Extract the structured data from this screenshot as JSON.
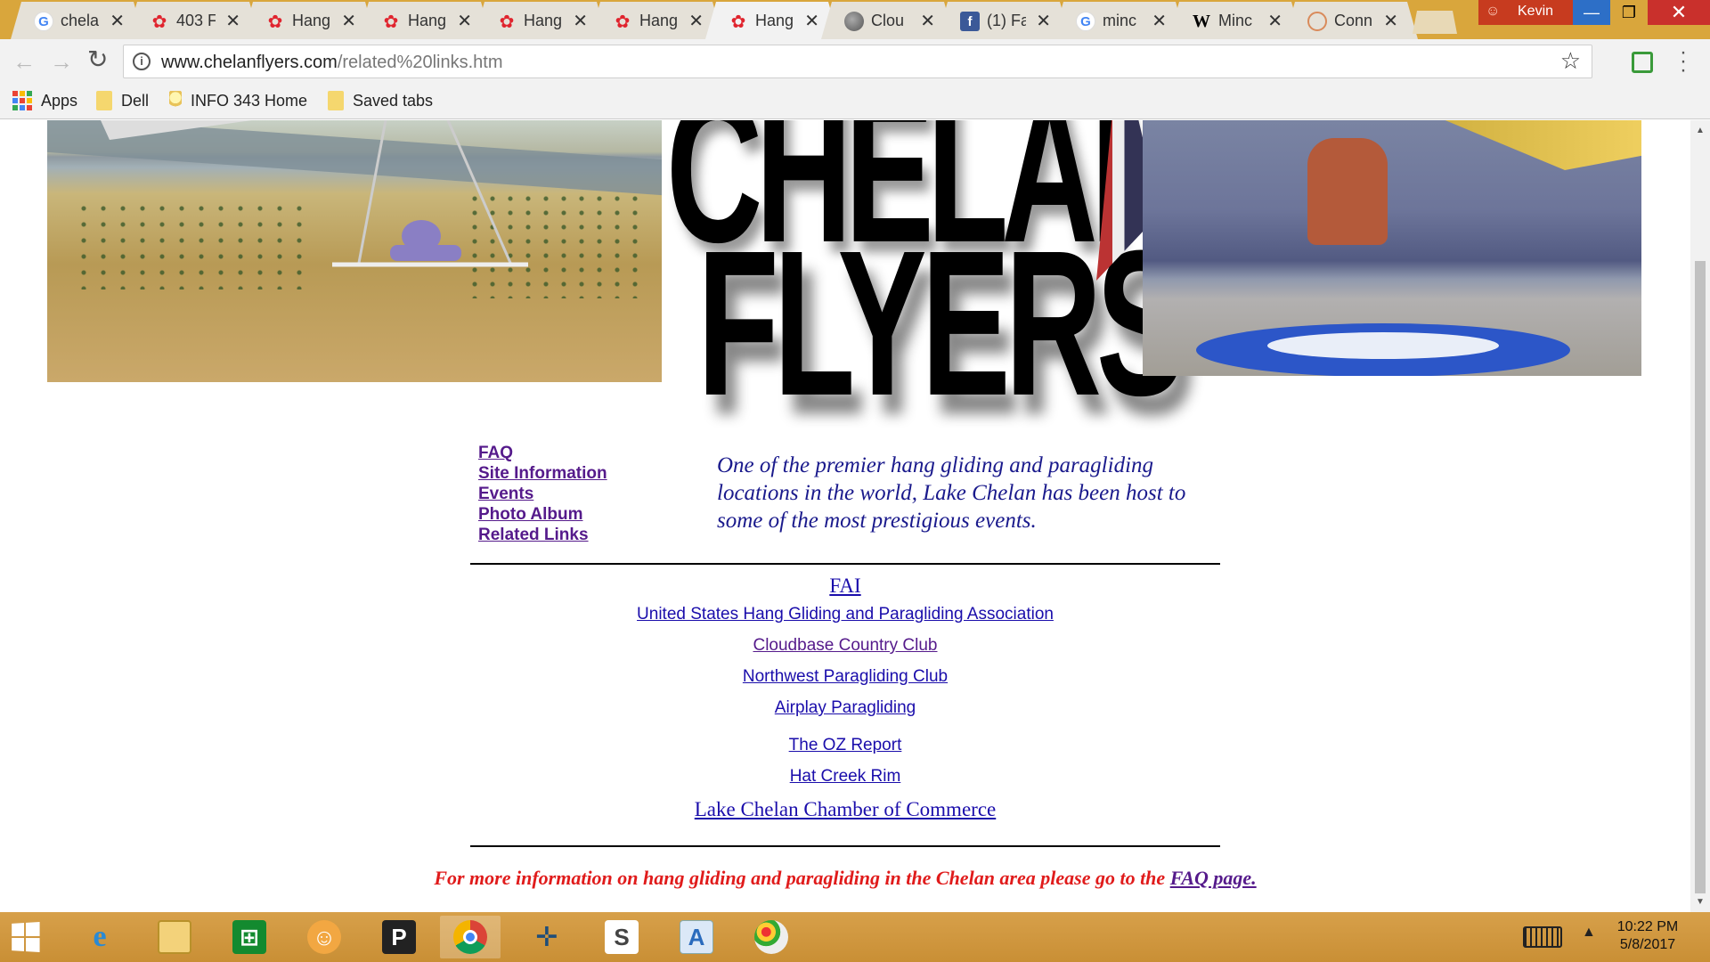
{
  "browser": {
    "tabs": [
      {
        "title": "chela",
        "favicon": "google-icon"
      },
      {
        "title": "403 F",
        "favicon": "hang-gliding-icon"
      },
      {
        "title": "Hang",
        "favicon": "hang-gliding-icon"
      },
      {
        "title": "Hang",
        "favicon": "hang-gliding-icon"
      },
      {
        "title": "Hang",
        "favicon": "hang-gliding-icon"
      },
      {
        "title": "Hang",
        "favicon": "hang-gliding-icon"
      },
      {
        "title": "Hang",
        "favicon": "hang-gliding-icon",
        "active": true
      },
      {
        "title": "Clou",
        "favicon": "cloud-icon"
      },
      {
        "title": "(1) Fa",
        "favicon": "facebook-icon"
      },
      {
        "title": "minc",
        "favicon": "google-icon"
      },
      {
        "title": "Minc",
        "favicon": "wikipedia-icon"
      },
      {
        "title": "Conn",
        "favicon": "ring-icon"
      }
    ],
    "close_glyph": "✕",
    "profile_name": "Kevin",
    "window_controls": {
      "minimize": "—",
      "maximize": "❐",
      "close": "✕"
    },
    "address": {
      "domain": "www.chelanflyers.com",
      "path": "/related%20links.htm"
    },
    "bookmarks": [
      {
        "label": "Apps",
        "icon": "apps-icon"
      },
      {
        "label": "Dell",
        "icon": "folder-icon"
      },
      {
        "label": "INFO 343 Home",
        "icon": "lightbulb-icon"
      },
      {
        "label": "Saved tabs",
        "icon": "folder-icon"
      }
    ]
  },
  "page": {
    "logo_line1": "CHELAN",
    "logo_line2": "FLYERS",
    "nav": [
      "FAQ",
      "Site Information",
      "Events",
      "Photo Album",
      "Related Links"
    ],
    "tagline": "One of the premier hang gliding and paragliding locations in the world, Lake Chelan has been host to some of the most prestigious events.",
    "related_links": [
      {
        "label": "FAI"
      },
      {
        "label": "United States Hang Gliding and Paragliding Association"
      },
      {
        "label": "Cloudbase Country Club"
      },
      {
        "label": "Northwest Paragliding Club"
      },
      {
        "label": "Airplay Paragliding"
      },
      {
        "label": "The OZ Report"
      },
      {
        "label": "Hat Creek Rim"
      },
      {
        "label": "Lake Chelan Chamber of Commerce"
      }
    ],
    "footer_text": "For more information on hang gliding and paragliding in the Chelan area please go to the ",
    "footer_link": "FAQ page."
  },
  "taskbar": {
    "apps": [
      "internet-explorer-icon",
      "file-explorer-icon",
      "store-icon",
      "scratch-icon",
      "p-app-icon",
      "chrome-icon",
      "tableau-icon",
      "slack-icon",
      "wordpad-icon",
      "paint-icon"
    ],
    "time": "10:22 PM",
    "date": "5/8/2017"
  },
  "colors": {
    "link": "#1a0dab",
    "visited": "#551a8b",
    "tagline": "#1a1a8c",
    "footer": "#e01b1b",
    "frame": "#d9a63c"
  }
}
